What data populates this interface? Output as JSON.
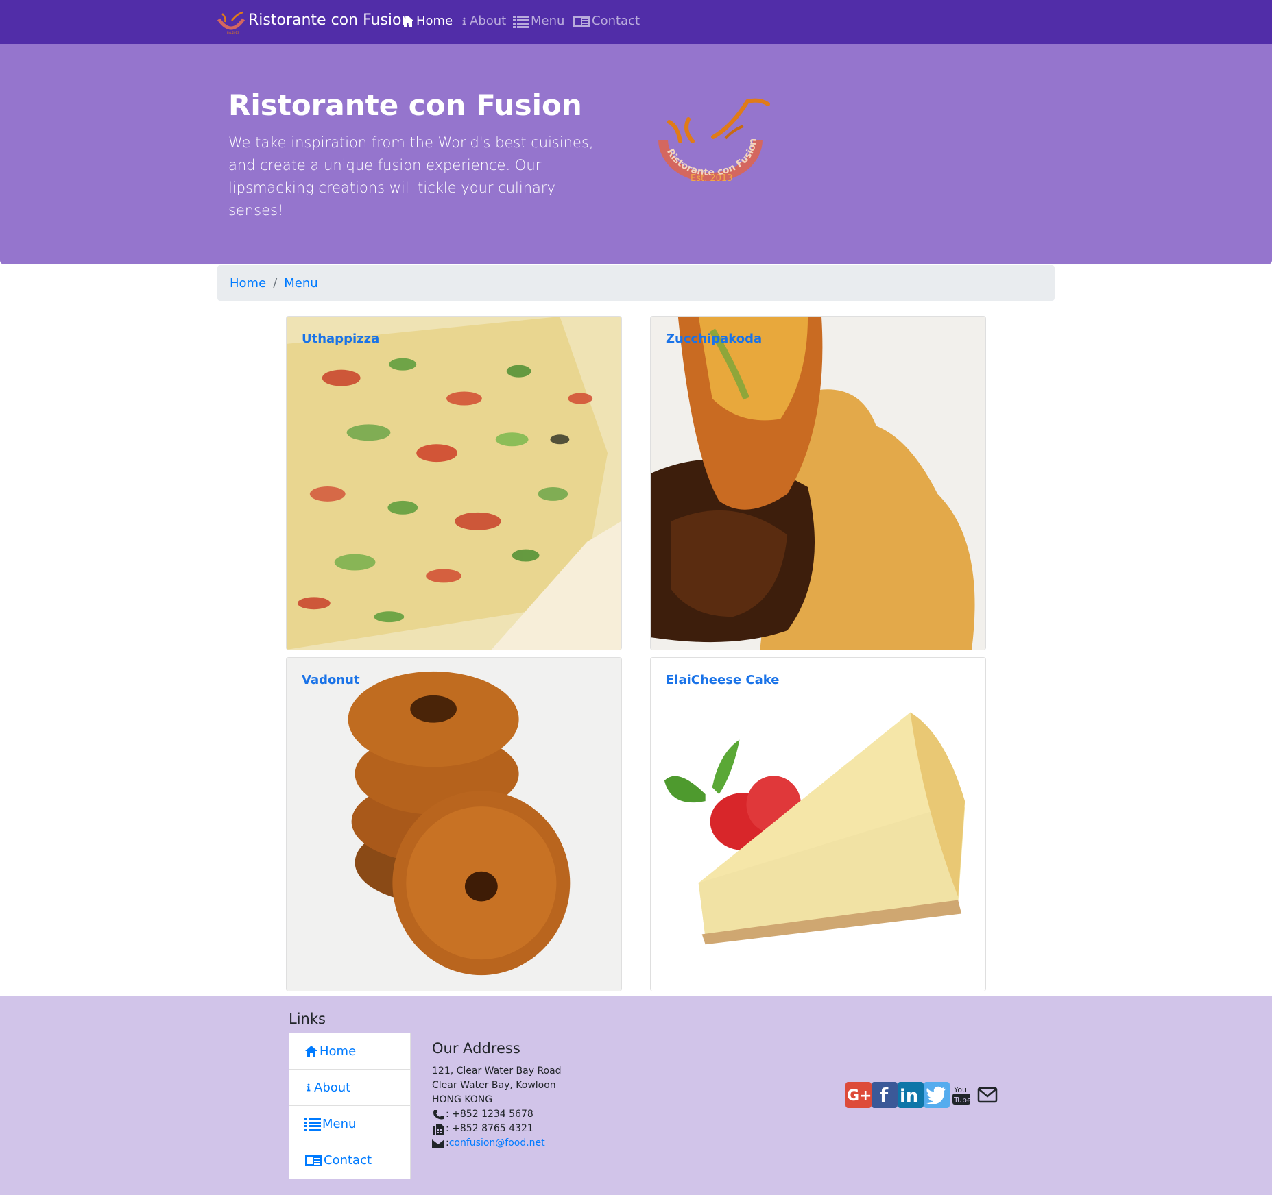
{
  "navbar": {
    "brand": "Ristorante con Fusion",
    "items": [
      {
        "label": "Home",
        "icon": "home-icon",
        "active": true
      },
      {
        "label": "About",
        "icon": "info-icon",
        "active": false
      },
      {
        "label": "Menu",
        "icon": "list-icon",
        "active": false
      },
      {
        "label": "Contact",
        "icon": "address-card-icon",
        "active": false
      }
    ]
  },
  "jumbotron": {
    "title": "Ristorante con Fusion",
    "lead": "We take inspiration from the World's best cuisines, and create a unique fusion experience. Our lipsmacking creations will tickle your culinary senses!",
    "logo_text": "Ristorante con Fusion",
    "logo_est": "Est. 2013"
  },
  "breadcrumb": {
    "home": "Home",
    "current": "Menu"
  },
  "dishes": [
    {
      "name": "Uthappizza"
    },
    {
      "name": "Zucchipakoda"
    },
    {
      "name": "Vadonut"
    },
    {
      "name": "ElaiCheese Cake"
    }
  ],
  "footer": {
    "links_title": "Links",
    "links": [
      "Home",
      "About",
      "Menu",
      "Contact"
    ],
    "address_title": "Our Address",
    "address_lines": [
      "121, Clear Water Bay Road",
      "Clear Water Bay, Kowloon",
      "HONG KONG"
    ],
    "phone": ": +852 1234 5678",
    "fax": ": +852 8765 4321",
    "email": "confusion@food.net",
    "social": [
      "google-plus-icon",
      "facebook-icon",
      "linkedin-icon",
      "twitter-icon",
      "youtube-icon",
      "envelope-icon"
    ]
  },
  "colors": {
    "navbar": "#512DA8",
    "jumbotron": "#9575CD",
    "footer": "#D1C4E9",
    "link": "#007bff"
  }
}
